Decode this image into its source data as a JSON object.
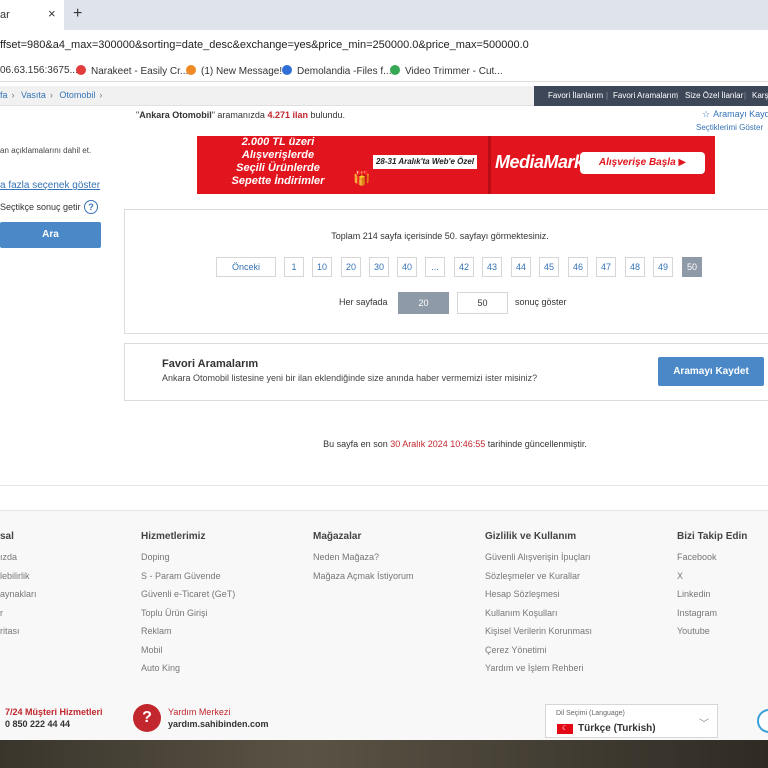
{
  "browser": {
    "tab_title": "ar",
    "tab_close": "×",
    "new_tab": "+",
    "url": "ffset=980&a4_max=300000&sorting=date_desc&exchange=yes&price_min=250000.0&price_max=500000.0",
    "bookmarks": [
      {
        "label": "06.63.156:3675...",
        "color": "#888888"
      },
      {
        "label": "Narakeet - Easily Cr...",
        "color": "#e23b3b"
      },
      {
        "label": "(1) New Message!",
        "color": "#f08a24"
      },
      {
        "label": "Demolandia -Files f...",
        "color": "#2f6fd6"
      },
      {
        "label": "Video Trimmer - Cut...",
        "color": "#34a853"
      }
    ]
  },
  "header": {
    "breadcrumbs": [
      "fa",
      "Vasıta",
      "Otomobil"
    ],
    "nav": [
      "Favori İlanlarım",
      "Favori Aramalarım",
      "Size Özel İlanlar",
      "Karş"
    ]
  },
  "results": {
    "query": "Ankara Otomobil",
    "prefix": "\"",
    "mid": "\" aramanızda ",
    "count": "4.271 ilan",
    "suffix": " bulundu.",
    "save_search": "Aramayı Kayd",
    "selected": "Seçtiklerimi Göster"
  },
  "left_panel": {
    "desc": "an açıklamalarını dahil et.",
    "more_options": "a fazla seçenek göster",
    "auto_results": "Seçtikçe sonuç getir",
    "help": "?",
    "search_button": "Ara"
  },
  "banner": {
    "left_line1": "2.000 TL üzeri",
    "left_line2": "Alışverişlerde",
    "left_line3": "Seçili Ürünlerde",
    "left_line4": "Sepette İndirimler",
    "date": "28-31 Aralık'ta Web'e Özel",
    "brand": "MediaMarkt",
    "cta": "Alışverişe Başla"
  },
  "pagination": {
    "info": "Toplam 214 sayfa içerisinde 50. sayfayı görmektesiniz.",
    "prev": "Önceki",
    "pages": [
      "1",
      "10",
      "20",
      "30",
      "40",
      "...",
      "42",
      "43",
      "44",
      "45",
      "46",
      "47",
      "48",
      "49",
      "50"
    ],
    "current": "50",
    "per_page_label": "Her sayfada",
    "per_page_options": [
      "20",
      "50"
    ],
    "per_page_active": "20",
    "per_page_suffix": "sonuç göster"
  },
  "favorites": {
    "title": "Favori Aramalarım",
    "desc": "Ankara Otomobil listesine yeni bir ilan eklendiğinde size anında haber vermemizi ister misiniz?",
    "button": "Aramayı Kaydet"
  },
  "updated": {
    "prefix": "Bu sayfa en son ",
    "timestamp": "30 Aralık 2024 10:46:55",
    "suffix": " tarihinde güncellenmiştir."
  },
  "footer": {
    "columns": [
      {
        "title": "sal",
        "links": [
          "ızda",
          "lebilirlik",
          "aynakları",
          "r",
          "ritası"
        ]
      },
      {
        "title": "Hizmetlerimiz",
        "links": [
          "Doping",
          "S - Param Güvende",
          "Güvenli e-Ticaret (GeT)",
          "Toplu Ürün Girişi",
          "Reklam",
          "Mobil",
          "Auto King"
        ]
      },
      {
        "title": "Mağazalar",
        "links": [
          "Neden Mağaza?",
          "Mağaza Açmak İstiyorum"
        ]
      },
      {
        "title": "Gizlilik ve Kullanım",
        "links": [
          "Güvenli Alışverişin İpuçları",
          "Sözleşmeler ve Kurallar",
          "Hesap Sözleşmesi",
          "Kullanım Koşulları",
          "Kişisel Verilerin Korunması",
          "Çerez Yönetimi",
          "Yardım ve İşlem Rehberi"
        ]
      },
      {
        "title": "Bizi Takip Edin",
        "links": [
          "Facebook",
          "X",
          "Linkedin",
          "Instagram",
          "Youtube"
        ]
      }
    ],
    "support_title": "7/24 Müşteri Hizmetleri",
    "support_phone": "0 850 222 44 44",
    "help_title": "Yardım Merkezi",
    "help_url": "yardım.sahibinden.com",
    "lang_label": "Dil Seçimi (Language)",
    "lang_value": "Türkçe (Turkish)"
  }
}
